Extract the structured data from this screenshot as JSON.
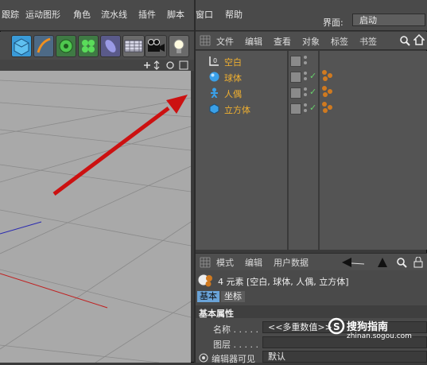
{
  "menubar": {
    "items": [
      "跟踪",
      "运动图形",
      "角色",
      "流水线",
      "插件",
      "脚本",
      "窗口",
      "帮助"
    ],
    "layout_label": "界面:",
    "layout_value": "启动"
  },
  "toolbar": {
    "tools": [
      "cube-icon",
      "pen-icon",
      "gear-green-icon",
      "cloner-icon",
      "deformer-icon",
      "floor-icon",
      "camera-icon",
      "light-icon"
    ]
  },
  "object_manager": {
    "tabs": [
      "文件",
      "编辑",
      "查看",
      "对象",
      "标签",
      "书签"
    ],
    "objects": [
      {
        "name": "空白",
        "icon": "null-icon",
        "checked": false,
        "has_tag": false
      },
      {
        "name": "球体",
        "icon": "sphere-icon",
        "checked": true,
        "has_tag": true
      },
      {
        "name": "人偶",
        "icon": "figure-icon",
        "checked": true,
        "has_tag": true
      },
      {
        "name": "立方体",
        "icon": "cube-icon",
        "checked": true,
        "has_tag": true
      }
    ]
  },
  "attribute_manager": {
    "tabs": [
      "模式",
      "编辑",
      "用户数据"
    ],
    "title": "4 元素 [空白, 球体, 人偶, 立方体]",
    "sub_tabs": [
      "基本",
      "坐标"
    ],
    "section": "基本属性",
    "fields": [
      {
        "label": "名称 . . . . .",
        "value": "<<多重数值>>"
      },
      {
        "label": "图层 . . . . .",
        "value": ""
      },
      {
        "label": "编辑器可见",
        "value": "默认"
      }
    ]
  },
  "watermark": {
    "brand": "搜狗指南",
    "url": "zhinan.sogou.com"
  },
  "colors": {
    "accent_blue": "#6aa3d8",
    "object_name": "#f0b030",
    "arrow_red": "#cc1111"
  }
}
